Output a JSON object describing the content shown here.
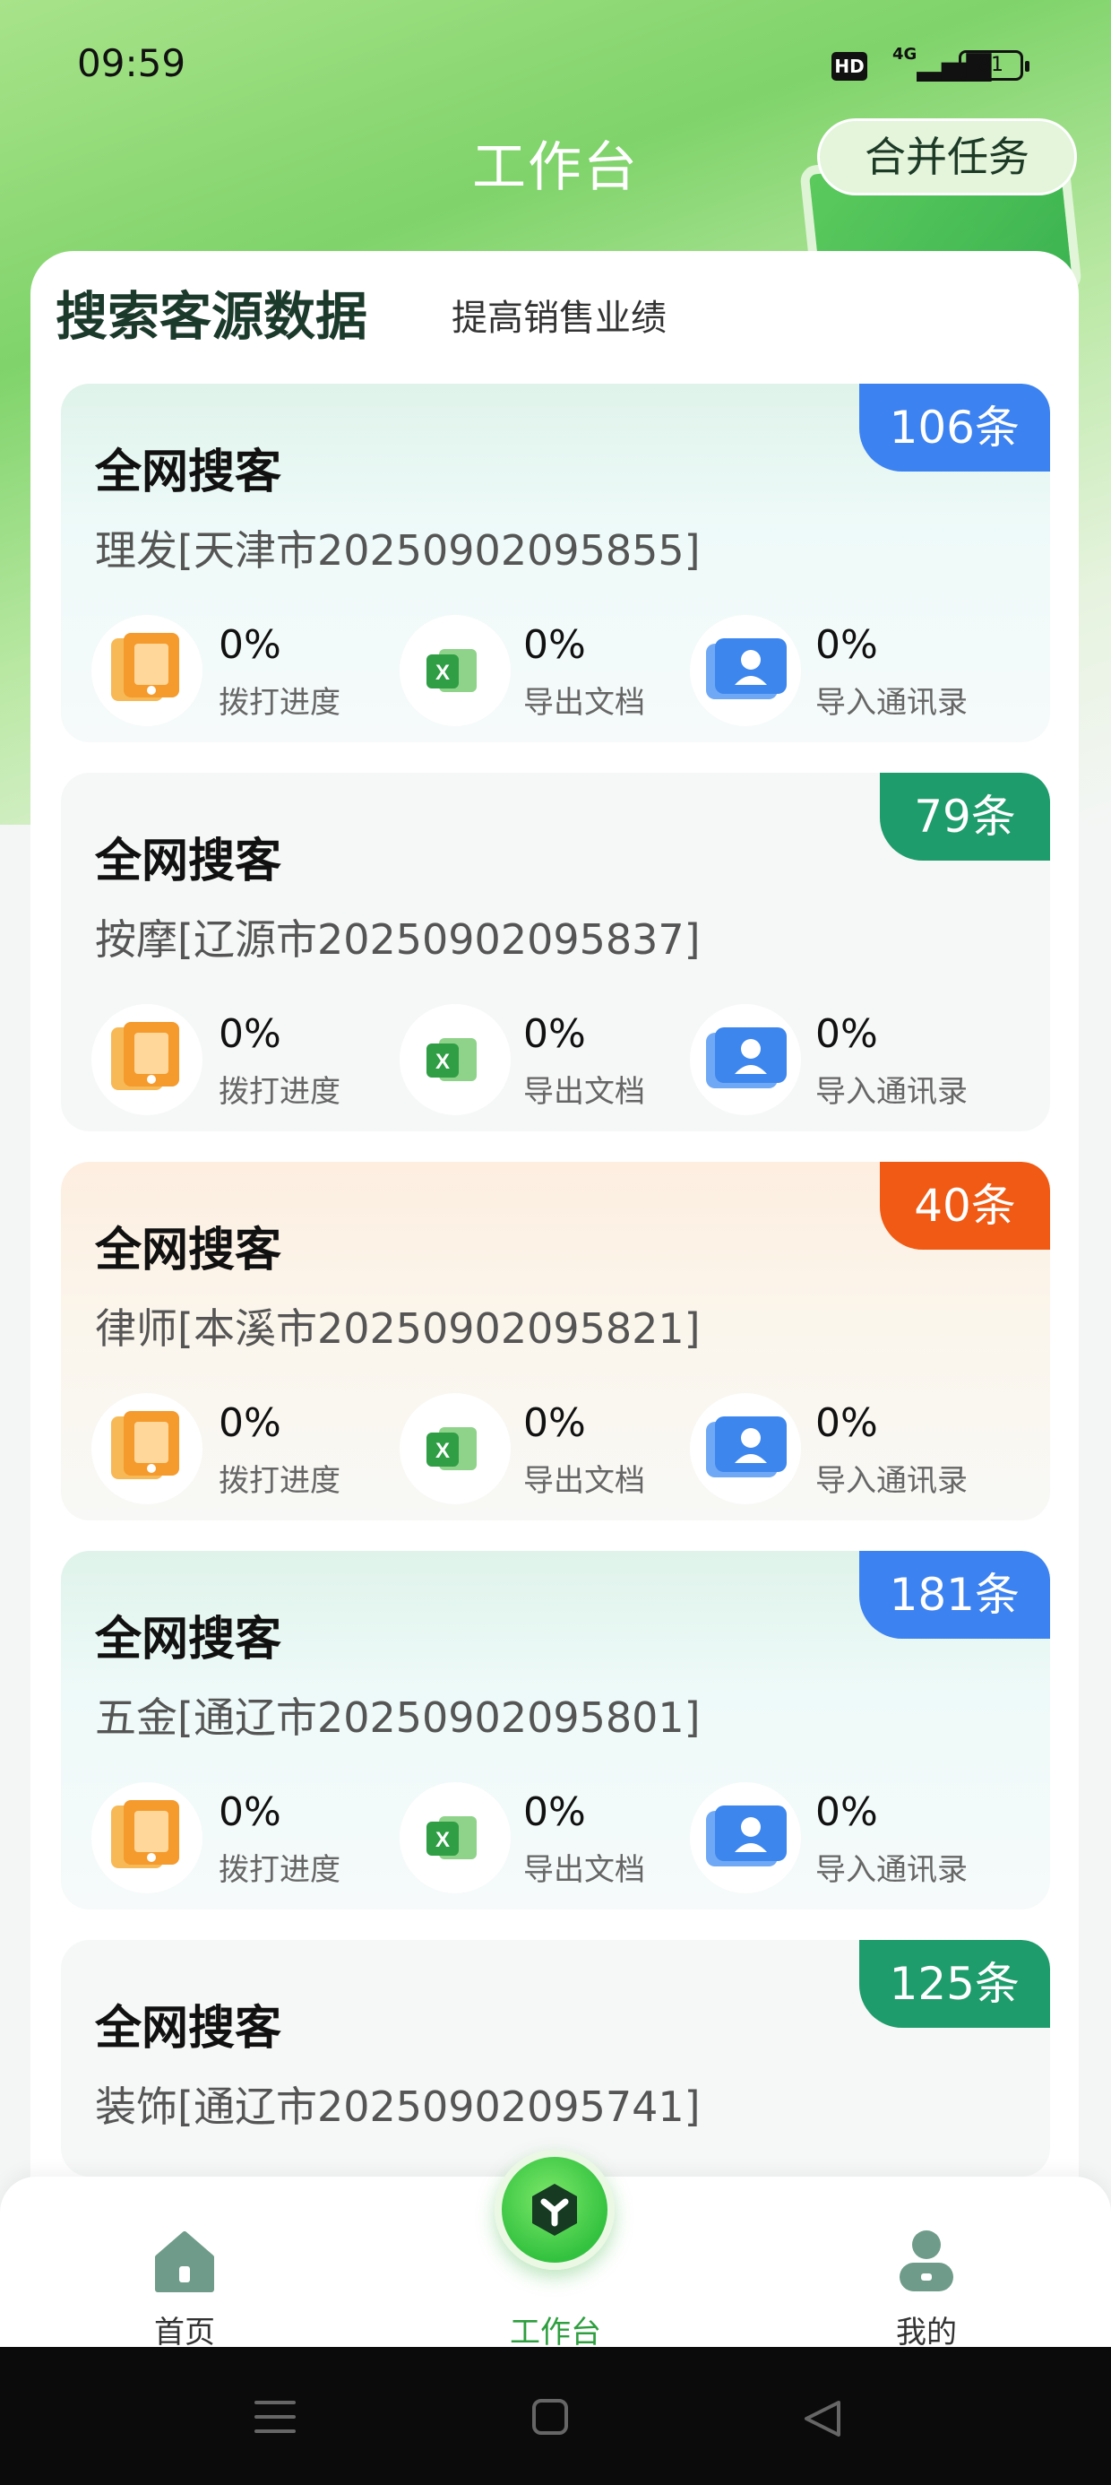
{
  "status_bar": {
    "time": "09:59",
    "hd": "HD",
    "signal": "4G",
    "battery": "81"
  },
  "header": {
    "title": "工作台",
    "merge_button": "合并任务"
  },
  "panel": {
    "title": "搜索客源数据",
    "subtitle": "提高销售业绩"
  },
  "stat_labels": {
    "dial": "拨打进度",
    "export": "导出文档",
    "contacts": "导入通讯录"
  },
  "cards": [
    {
      "title": "全网搜客",
      "subtitle": "理发[天津市20250902095855]",
      "badge": "106条",
      "dial": "0%",
      "export": "0%",
      "contacts": "0%"
    },
    {
      "title": "全网搜客",
      "subtitle": "按摩[辽源市20250902095837]",
      "badge": "79条",
      "dial": "0%",
      "export": "0%",
      "contacts": "0%"
    },
    {
      "title": "全网搜客",
      "subtitle": "律师[本溪市20250902095821]",
      "badge": "40条",
      "dial": "0%",
      "export": "0%",
      "contacts": "0%"
    },
    {
      "title": "全网搜客",
      "subtitle": "五金[通辽市20250902095801]",
      "badge": "181条",
      "dial": "0%",
      "export": "0%",
      "contacts": "0%"
    },
    {
      "title": "全网搜客",
      "subtitle": "装饰[通辽市20250902095741]",
      "badge": "125条"
    }
  ],
  "tabbar": {
    "home": "首页",
    "workbench": "工作台",
    "mine": "我的"
  },
  "colors": {
    "active_tab": "#2e9f3f",
    "badge_blue": "#3d82f1",
    "badge_teal": "#1f9c6c",
    "badge_orange": "#f05a14"
  }
}
